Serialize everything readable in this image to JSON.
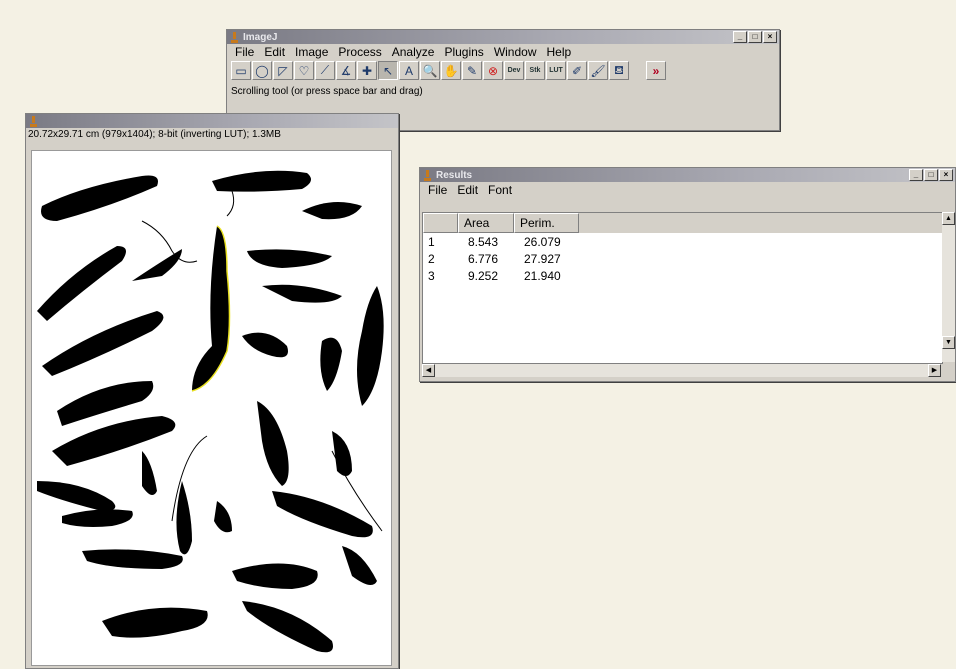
{
  "imagej": {
    "title": "ImageJ",
    "menu": [
      "File",
      "Edit",
      "Image",
      "Process",
      "Analyze",
      "Plugins",
      "Window",
      "Help"
    ],
    "tools": [
      {
        "icon": "rectangle-tool-icon",
        "glyph": "▭"
      },
      {
        "icon": "oval-tool-icon",
        "glyph": "◯"
      },
      {
        "icon": "polygon-tool-icon",
        "glyph": "◸"
      },
      {
        "icon": "freehand-tool-icon",
        "glyph": "♡"
      },
      {
        "icon": "line-tool-icon",
        "glyph": "⟋"
      },
      {
        "icon": "angle-tool-icon",
        "glyph": "∡"
      },
      {
        "icon": "point-tool-icon",
        "glyph": "✚"
      },
      {
        "icon": "wand-tool-icon",
        "glyph": "↖"
      },
      {
        "icon": "text-tool-icon",
        "glyph": "A"
      },
      {
        "icon": "magnifier-tool-icon",
        "glyph": "🔍"
      },
      {
        "icon": "scrolling-tool-icon",
        "glyph": "✋"
      },
      {
        "icon": "dropper-tool-icon",
        "glyph": "✎"
      },
      {
        "icon": "stop-tool-icon",
        "glyph": "⊗"
      },
      {
        "icon": "dev-tool-icon",
        "glyph": "Dev"
      },
      {
        "icon": "stk-tool-icon",
        "glyph": "Stk"
      },
      {
        "icon": "lut-tool-icon",
        "glyph": "LUT"
      },
      {
        "icon": "pencil-tool-icon",
        "glyph": "✐"
      },
      {
        "icon": "brush-tool-icon",
        "glyph": "🖌"
      },
      {
        "icon": "flood-fill-tool-icon",
        "glyph": "⛾"
      },
      {
        "icon": "more-tools-icon",
        "glyph": "»"
      }
    ],
    "status": "Scrolling tool (or press space bar and drag)"
  },
  "image_window": {
    "info": "20.72x29.71 cm (979x1404); 8-bit (inverting LUT); 1.3MB"
  },
  "results": {
    "title": "Results",
    "menu": [
      "File",
      "Edit",
      "Font"
    ],
    "columns": [
      "",
      "Area",
      "Perim."
    ],
    "rows": [
      [
        "1",
        "8.543",
        "26.079"
      ],
      [
        "2",
        "6.776",
        "27.927"
      ],
      [
        "3",
        "9.252",
        "21.940"
      ]
    ]
  }
}
